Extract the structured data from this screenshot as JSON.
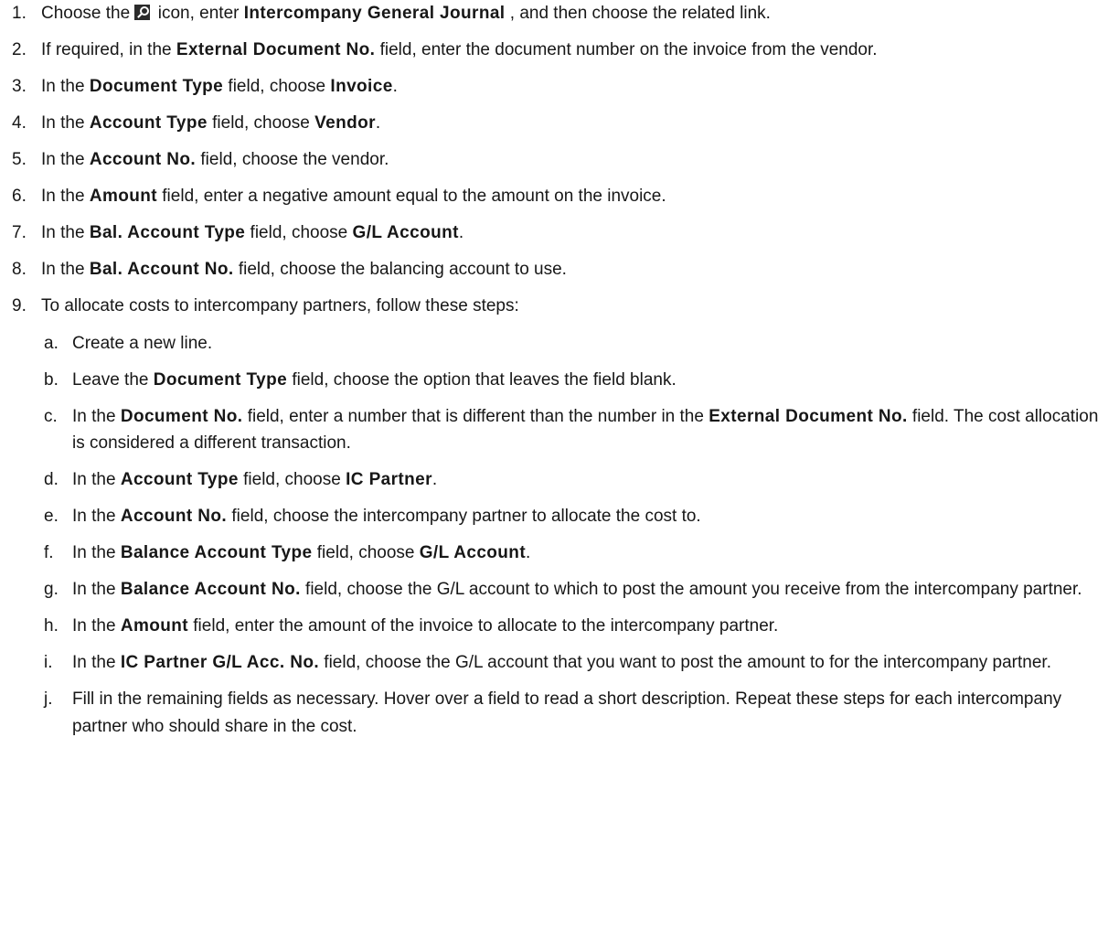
{
  "steps": [
    {
      "n": "1.",
      "a": "Choose the ",
      "icon": "search-icon",
      "b": " icon, enter ",
      "c": "Intercompany General Journal",
      "d": " , and then choose the related link."
    },
    {
      "n": "2.",
      "a": "If required, in the ",
      "b": "External Document No.",
      "c": " field, enter the document number on the invoice from the vendor."
    },
    {
      "n": "3.",
      "a": "In the ",
      "b": "Document Type",
      "c": " field, choose ",
      "d": "Invoice",
      "e": "."
    },
    {
      "n": "4.",
      "a": "In the ",
      "b": "Account Type",
      "c": " field, choose ",
      "d": "Vendor",
      "e": "."
    },
    {
      "n": "5.",
      "a": "In the ",
      "b": "Account No.",
      "c": " field, choose the vendor."
    },
    {
      "n": "6.",
      "a": "In the ",
      "b": "Amount",
      "c": " field, enter a negative amount equal to the amount on the invoice."
    },
    {
      "n": "7.",
      "a": "In the ",
      "b": "Bal. Account Type",
      "c": " field, choose ",
      "d": "G/L Account",
      "e": "."
    },
    {
      "n": "8.",
      "a": "In the ",
      "b": "Bal. Account No.",
      "c": " field, choose the balancing account to use."
    },
    {
      "n": "9.",
      "a": "To allocate costs to intercompany partners, follow these steps:"
    }
  ],
  "substeps": [
    {
      "n": "a.",
      "a": "Create a new line."
    },
    {
      "n": "b.",
      "a": "Leave the ",
      "b": "Document Type",
      "c": " field, choose the option that leaves the field blank."
    },
    {
      "n": "c.",
      "a": "In the ",
      "b": "Document No.",
      "c": " field, enter a number that is different than the number in the ",
      "d": "External Document No.",
      "e": " field. The cost allocation is considered a different transaction."
    },
    {
      "n": "d.",
      "a": "In the ",
      "b": "Account Type",
      "c": " field, choose ",
      "d": "IC Partner",
      "e": "."
    },
    {
      "n": "e.",
      "a": "In the ",
      "b": "Account No.",
      "c": " field, choose the intercompany partner to allocate the cost to."
    },
    {
      "n": "f.",
      "a": "In the ",
      "b": "Balance Account Type",
      "c": " field, choose ",
      "d": "G/L Account",
      "e": "."
    },
    {
      "n": "g.",
      "a": "In the ",
      "b": "Balance Account No.",
      "c": " field, choose the G/L account to which to post the amount you receive from the intercompany partner."
    },
    {
      "n": "h.",
      "a": "In the ",
      "b": "Amount",
      "c": " field, enter the amount of the invoice to allocate to the intercompany partner."
    },
    {
      "n": "i.",
      "a": "In the ",
      "b": "IC Partner G/L Acc. No.",
      "c": " field, choose the G/L account that you want to post the amount to for the intercompany partner."
    },
    {
      "n": "j.",
      "a": "Fill in the remaining fields as necessary. Hover over a field to read a short description. Repeat these steps for each intercompany partner who should share in the cost."
    }
  ]
}
